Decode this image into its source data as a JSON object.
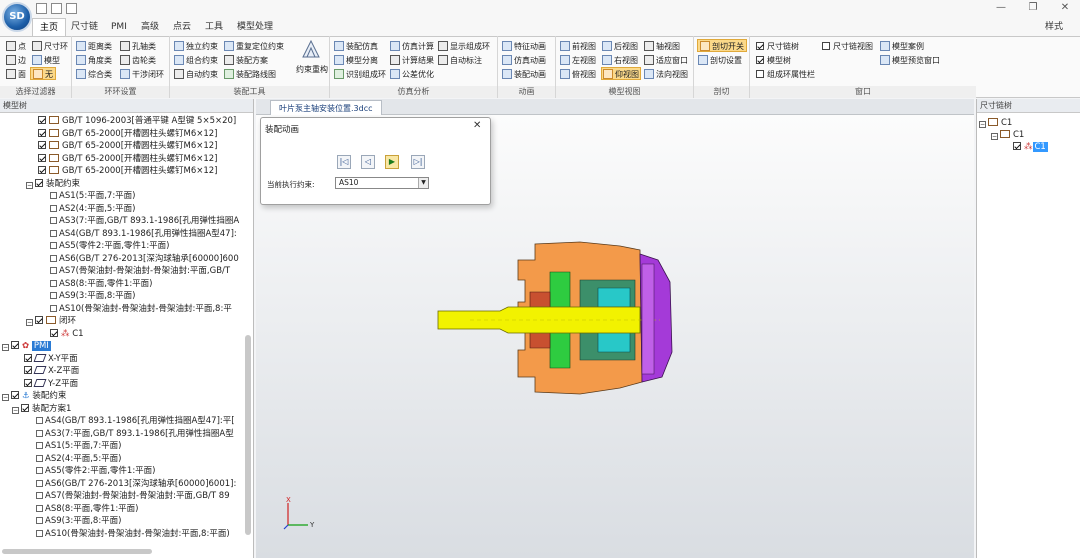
{
  "app": {
    "logo": "SD"
  },
  "window": {
    "minimize": "—",
    "restore": "❐",
    "close": "✕",
    "style_label": "样式"
  },
  "tabs": [
    "主页",
    "尺寸链",
    "PMI",
    "高级",
    "点云",
    "工具",
    "模型处理"
  ],
  "ribbon": {
    "g1": {
      "label": "选择过滤器",
      "items": [
        "点",
        "尺寸环",
        "边",
        "模型",
        "面",
        "无"
      ]
    },
    "g2": {
      "label": "环环设置",
      "items": [
        "距离类",
        "孔轴类",
        "角度类",
        "齿轮类",
        "综合类",
        "干涉闭环"
      ]
    },
    "g3": {
      "label": "装配工具",
      "items": [
        "独立约束",
        "重复定位约束",
        "组合约束",
        "装配方案",
        "自动约束",
        "装配路线图"
      ],
      "big": "约束重构"
    },
    "g4": {
      "label": "仿真分析",
      "items": [
        "装配仿真",
        "仿真计算",
        "显示组成环",
        "模型分离",
        "计算结果",
        "自动标注",
        "识别组成环",
        "公差优化"
      ]
    },
    "g5": {
      "label": "动画",
      "items": [
        "特征动画",
        "仿真动画",
        "装配动画"
      ]
    },
    "g6": {
      "label": "模型视图",
      "items": [
        "前视图",
        "后视图",
        "轴视图",
        "左视图",
        "右视图",
        "适应窗口",
        "俯视图",
        "仰视图",
        "法向视图"
      ]
    },
    "g7": {
      "label": "剖切",
      "items": [
        "剖切开关",
        "剖切设置"
      ]
    },
    "g8": {
      "label": "窗口",
      "items": [
        "尺寸链树",
        "尺寸链视图",
        "模型案例",
        "模型树",
        "模型预览窗口",
        "组成环属性栏"
      ]
    }
  },
  "left_panel": {
    "title": "模型树",
    "rows": [
      "GB/T 1096-2003[普通平键 A型键 5×5×20]",
      "GB/T 65-2000[开槽圆柱头螺钉M6×12]",
      "GB/T 65-2000[开槽圆柱头螺钉M6×12]",
      "GB/T 65-2000[开槽圆柱头螺钉M6×12]",
      "GB/T 65-2000[开槽圆柱头螺钉M6×12]",
      "装配约束",
      "AS1(5:平面,7:平面)",
      "AS2(4:平面,5:平面)",
      "AS3(7:平面,GB/T 893.1-1986[孔用弹性挡圈A",
      "AS4(GB/T 893.1-1986[孔用弹性挡圈A型47]:",
      "AS5(零件2:平面,零件1:平面)",
      "AS6(GB/T 276-2013[深沟球轴承[60000]600",
      "AS7(骨架油封-骨架油封-骨架油封:平面,GB/T",
      "AS8(8:平面,零件1:平面)",
      "AS9(3:平面,8:平面)",
      "AS10(骨架油封-骨架油封-骨架油封:平面,8:平",
      "闭环",
      "C1",
      "PMI",
      "X-Y平面",
      "X-Z平面",
      "Y-Z平面",
      "装配约束",
      "装配方案1",
      "AS4(GB/T 893.1-1986[孔用弹性挡圈A型47]:平[",
      "AS3(7:平面,GB/T 893.1-1986[孔用弹性挡圈A型",
      "AS1(5:平面,7:平面)",
      "AS2(4:平面,5:平面)",
      "AS5(零件2:平面,零件1:平面)",
      "AS6(GB/T 276-2013[深沟球轴承[60000]6001]:",
      "AS7(骨架油封-骨架油封-骨架油封:平面,GB/T 89",
      "AS8(8:平面,零件1:平面)",
      "AS9(3:平面,8:平面)",
      "AS10(骨架油封-骨架油封-骨架油封:平面,8:平面)"
    ]
  },
  "viewport": {
    "tab": "叶片泵主轴安装位置.3dcc",
    "axis_x": "X",
    "axis_y": "Y"
  },
  "dialog": {
    "title": "装配动画",
    "close": "✕",
    "field_label": "当前执行约束:",
    "field_value": "AS10",
    "buttons": [
      "first",
      "prev",
      "play",
      "last"
    ]
  },
  "right_panel": {
    "title": "尺寸链树",
    "rows": [
      "C1",
      "C1",
      "C1"
    ]
  },
  "colors": {
    "accent": "#2a7bd4",
    "selected": "#3399ff",
    "orange": "#f39a4a",
    "purple": "#a43ad8",
    "yellow": "#f2f200",
    "green": "#2ecc40"
  }
}
